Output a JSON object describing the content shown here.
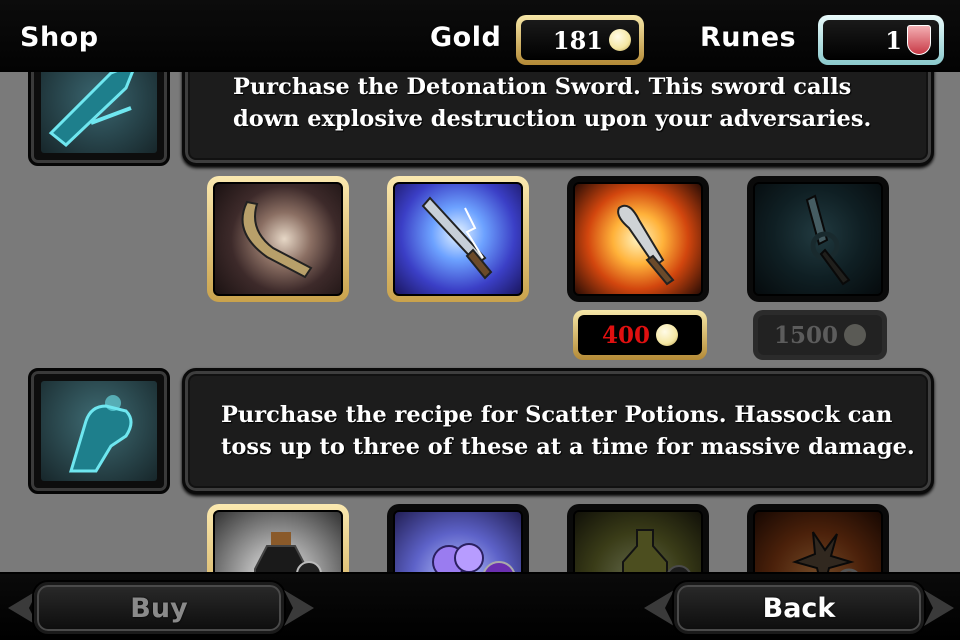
{
  "header": {
    "title": "Shop",
    "gold_label": "Gold",
    "gold_value": "181",
    "runes_label": "Runes",
    "runes_value": "1"
  },
  "sections": [
    {
      "description": "Purchase the Detonation Sword. This sword calls down explosive destruction upon your adversaries.",
      "icon": "sword-slash-icon",
      "items": [
        {
          "icon": "curved-blade-icon",
          "state": "owned"
        },
        {
          "icon": "lightning-sword-icon",
          "state": "owned"
        },
        {
          "icon": "explosion-sword-icon",
          "state": "available",
          "price": "400"
        },
        {
          "icon": "frost-sword-icon",
          "state": "locked",
          "price": "1500"
        }
      ]
    },
    {
      "description": "Purchase the recipe for Scatter Potions. Hassock can toss up to three of these at a time for massive damage.",
      "icon": "throwing-hand-icon",
      "items": [
        {
          "icon": "black-potion-icon",
          "state": "owned"
        },
        {
          "icon": "scatter-potions-icon",
          "state": "available"
        },
        {
          "icon": "green-potion-icon",
          "state": "locked"
        },
        {
          "icon": "clawed-potion-icon",
          "state": "locked"
        }
      ]
    }
  ],
  "footer": {
    "buy_label": "Buy",
    "back_label": "Back"
  },
  "colors": {
    "price_text": "#e01010",
    "gold_frame": "#e8cf86",
    "rune_frame": "#bfe9ea",
    "accent_icon": "#4fd1e0"
  }
}
